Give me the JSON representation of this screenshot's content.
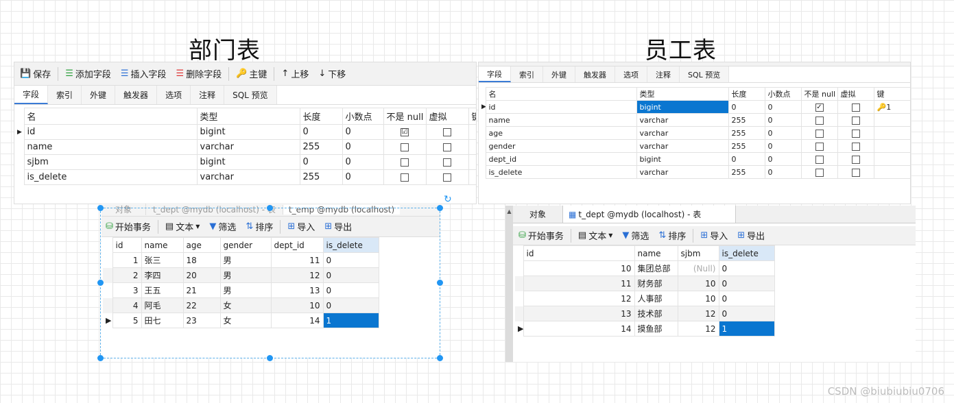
{
  "headings": {
    "dept": "部门表",
    "emp": "员工表"
  },
  "design_left": {
    "toolbar": [
      "保存",
      "添加字段",
      "插入字段",
      "删除字段",
      "主键",
      "上移",
      "下移"
    ],
    "tabs": [
      "字段",
      "索引",
      "外键",
      "触发器",
      "选项",
      "注释",
      "SQL 预览"
    ],
    "columns": [
      "名",
      "类型",
      "长度",
      "小数点",
      "不是 null",
      "虚拟",
      "键"
    ],
    "rows": [
      {
        "name": "id",
        "type": "bigint",
        "len": "0",
        "dec": "0",
        "notnull": "☑",
        "virt": ""
      },
      {
        "name": "name",
        "type": "varchar",
        "len": "255",
        "dec": "0",
        "notnull": "",
        "virt": ""
      },
      {
        "name": "sjbm",
        "type": "bigint",
        "len": "0",
        "dec": "0",
        "notnull": "",
        "virt": ""
      },
      {
        "name": "is_delete",
        "type": "varchar",
        "len": "255",
        "dec": "0",
        "notnull": "",
        "virt": ""
      }
    ]
  },
  "design_right": {
    "tabs": [
      "字段",
      "索引",
      "外键",
      "触发器",
      "选项",
      "注释",
      "SQL 预览"
    ],
    "columns": [
      "名",
      "类型",
      "长度",
      "小数点",
      "不是 null",
      "虚拟",
      "键"
    ],
    "rows": [
      {
        "name": "id",
        "type": "bigint",
        "len": "0",
        "dec": "0",
        "key": "1"
      },
      {
        "name": "name",
        "type": "varchar",
        "len": "255",
        "dec": "0",
        "key": ""
      },
      {
        "name": "age",
        "type": "varchar",
        "len": "255",
        "dec": "0",
        "key": ""
      },
      {
        "name": "gender",
        "type": "varchar",
        "len": "255",
        "dec": "0",
        "key": ""
      },
      {
        "name": "dept_id",
        "type": "bigint",
        "len": "0",
        "dec": "0",
        "key": ""
      },
      {
        "name": "is_delete",
        "type": "varchar",
        "len": "255",
        "dec": "0",
        "key": ""
      }
    ]
  },
  "data_left": {
    "tabbar": [
      "对象",
      "t_dept @mydb (localhost) - 表",
      "t_emp @mydb (localhost)"
    ],
    "toolbar": [
      "开始事务",
      "文本",
      "筛选",
      "排序",
      "导入",
      "导出"
    ],
    "columns": [
      "id",
      "name",
      "age",
      "gender",
      "dept_id",
      "is_delete"
    ],
    "rows": [
      [
        "1",
        "张三",
        "18",
        "男",
        "11",
        "0"
      ],
      [
        "2",
        "李四",
        "20",
        "男",
        "12",
        "0"
      ],
      [
        "3",
        "王五",
        "21",
        "男",
        "13",
        "0"
      ],
      [
        "4",
        "阿毛",
        "22",
        "女",
        "10",
        "0"
      ],
      [
        "5",
        "田七",
        "23",
        "女",
        "14",
        "1"
      ]
    ]
  },
  "data_right": {
    "tabbar": [
      "对象",
      "t_dept @mydb (localhost) - 表"
    ],
    "toolbar": [
      "开始事务",
      "文本",
      "筛选",
      "排序",
      "导入",
      "导出"
    ],
    "columns": [
      "id",
      "name",
      "sjbm",
      "is_delete"
    ],
    "rows": [
      [
        "10",
        "集团总部",
        "(Null)",
        "0"
      ],
      [
        "11",
        "财务部",
        "10",
        "0"
      ],
      [
        "12",
        "人事部",
        "10",
        "0"
      ],
      [
        "13",
        "技术部",
        "12",
        "0"
      ],
      [
        "14",
        "摸鱼部",
        "12",
        "1"
      ]
    ]
  },
  "watermark": "CSDN @biubiubiu0706",
  "colors": {
    "selection": "#0a76d0",
    "handle": "#2196f3",
    "key": "#d4a017"
  }
}
